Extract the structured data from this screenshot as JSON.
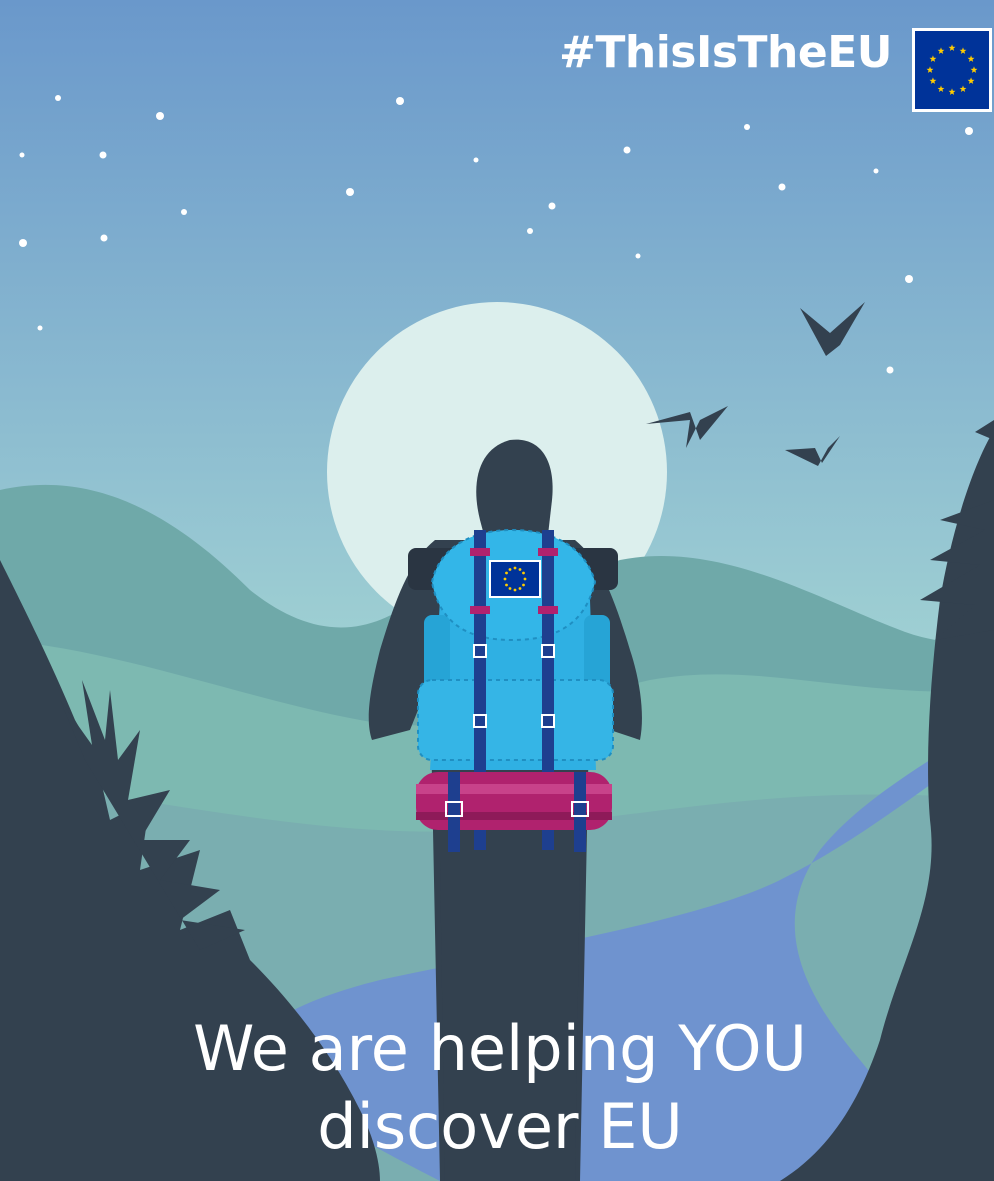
{
  "poster": {
    "hashtag": "#ThisIsTheEU",
    "headline_line1": "We are helping YOU",
    "headline_line2": "discover EU"
  },
  "icons": {
    "flag": "eu-flag-icon",
    "stars": "eu-stars-circle-icon",
    "backpack": "backpack-icon",
    "birds": "bird-icon"
  },
  "colors": {
    "sky_top": "#6b9bcc",
    "sky_bottom": "#9fd3d2",
    "moon": "#dff0ee",
    "silhouette": "#33414f",
    "hills": "#7fb8b0",
    "river": "#6f93cf",
    "backpack_blue": "#2fb0e3",
    "strap_navy": "#1e3f8f",
    "bedroll_magenta": "#b0226e",
    "eu_blue": "#003399",
    "eu_yellow": "#ffcc00",
    "text": "#ffffff"
  }
}
